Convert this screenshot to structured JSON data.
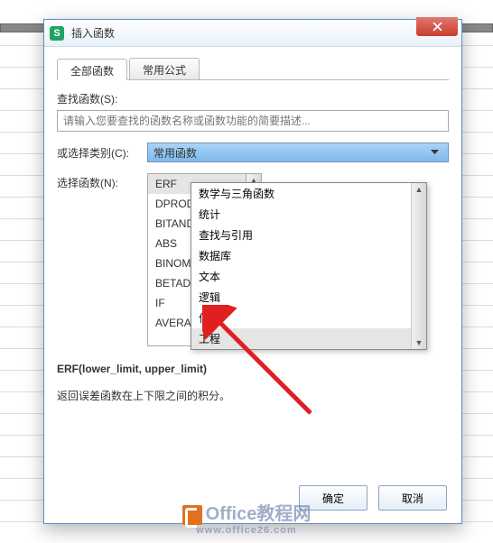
{
  "window": {
    "title": "插入函数",
    "icon_letter": "S"
  },
  "tabs": {
    "all_functions": "全部函数",
    "common_formula": "常用公式"
  },
  "search": {
    "label": "查找函数(S):",
    "placeholder": "请输入您要查找的函数名称或函数功能的简要描述..."
  },
  "category": {
    "label": "或选择类别(C):",
    "selected": "常用函数"
  },
  "dropdown_items": [
    "数学与三角函数",
    "统计",
    "查找与引用",
    "数据库",
    "文本",
    "逻辑",
    "信息",
    "工程"
  ],
  "dropdown_hover_index": 7,
  "select_fn_label": "选择函数(N):",
  "function_list": [
    "ERF",
    "DPRODUCT",
    "BITAND",
    "ABS",
    "BINOMDIST",
    "BETADIST",
    "IF",
    "AVERAGE"
  ],
  "function_selected_index": 0,
  "signature": "ERF(lower_limit, upper_limit)",
  "description": "返回误差函数在上下限之间的积分。",
  "buttons": {
    "ok": "确定",
    "cancel": "取消"
  },
  "watermark": {
    "brand": "Office教程网",
    "url": "www.office26.com"
  }
}
